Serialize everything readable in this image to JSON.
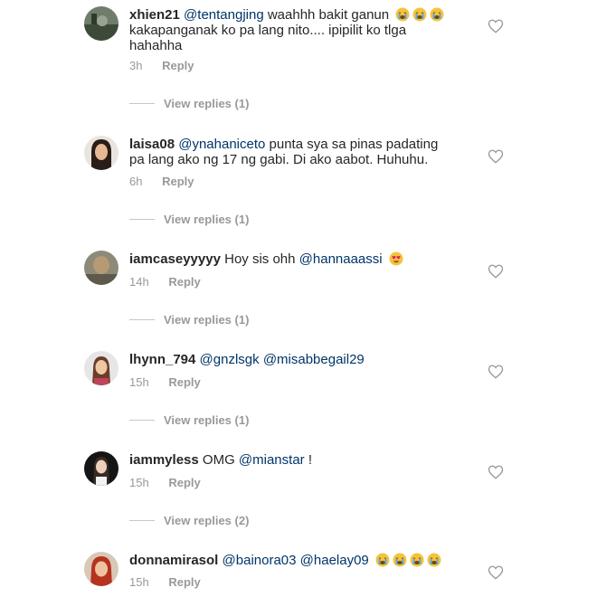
{
  "comments": [
    {
      "username": "xhien21",
      "mention": "@tentangjing",
      "text_line1": " waahhh bakit ganun",
      "emojis_line1": [
        "crying-face-icon",
        "crying-face-icon",
        "crying-face-icon"
      ],
      "text_line2": "kakapanganak ko pa lang nito.... ipipilit ko tlga",
      "text_line3": "hahahha",
      "time": "3h",
      "reply": "Reply",
      "view_replies": "View replies (1)"
    },
    {
      "username": "laisa08",
      "mention": "@ynahaniceto",
      "text_line1": "  punta sya sa pinas padating",
      "text_line2": "pa lang ako ng 17 ng gabi. Di ako aabot. Huhuhu.",
      "time": "6h",
      "reply": "Reply",
      "view_replies": "View replies (1)"
    },
    {
      "username": "iamcaseyyyyy",
      "text_line1": " Hoy sis ohh ",
      "mention_after": "@hannaaassi",
      "emojis_line1": [
        "heart-eyes-icon"
      ],
      "time": "14h",
      "reply": "Reply",
      "view_replies": "View replies (1)"
    },
    {
      "username": "lhynn_794",
      "mention": "@gnzlsgk",
      "mention2": "@misabbegail29",
      "time": "15h",
      "reply": "Reply",
      "view_replies": "View replies (1)"
    },
    {
      "username": "iammyless",
      "text_line1": " OMG ",
      "mention_after": "@mianstar",
      "text_after": " !",
      "time": "15h",
      "reply": "Reply",
      "view_replies": "View replies (2)"
    },
    {
      "username": "donnamirasol",
      "mention": "@bainora03",
      "mention2": "@haelay09",
      "emojis_line1": [
        "crying-face-icon",
        "crying-face-icon",
        "crying-face-icon",
        "crying-face-icon"
      ],
      "time": "15h",
      "reply": "Reply"
    }
  ],
  "colors": {
    "username": "#262626",
    "mention": "#003569",
    "meta": "#999999",
    "divider": "#c7c7c7"
  }
}
